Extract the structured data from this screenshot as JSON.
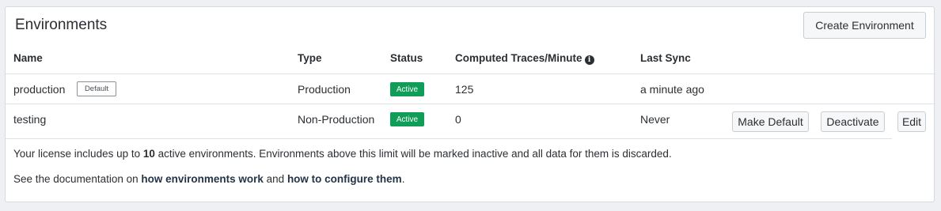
{
  "panel": {
    "title": "Environments",
    "create_button": "Create Environment"
  },
  "table": {
    "columns": {
      "name": "Name",
      "type": "Type",
      "status": "Status",
      "traces": "Computed Traces/Minute",
      "last_sync": "Last Sync"
    },
    "rows": [
      {
        "name": "production",
        "default_badge": "Default",
        "type": "Production",
        "status": "Active",
        "traces": "125",
        "last_sync": "a minute ago"
      },
      {
        "name": "testing",
        "type": "Non-Production",
        "status": "Active",
        "traces": "0",
        "last_sync": "Never",
        "actions": {
          "make_default": "Make Default",
          "deactivate": "Deactivate",
          "edit": "Edit"
        }
      }
    ]
  },
  "license_note": {
    "prefix": "Your license includes up to ",
    "count": "10",
    "suffix": " active environments. Environments above this limit will be marked inactive and all data for them is discarded."
  },
  "docs_note": {
    "prefix": "See the documentation on ",
    "link1": "how environments work",
    "middle": " and ",
    "link2": "how to configure them",
    "suffix": "."
  },
  "colors": {
    "status_active": "#0f9d58",
    "background": "#eef0f3"
  }
}
